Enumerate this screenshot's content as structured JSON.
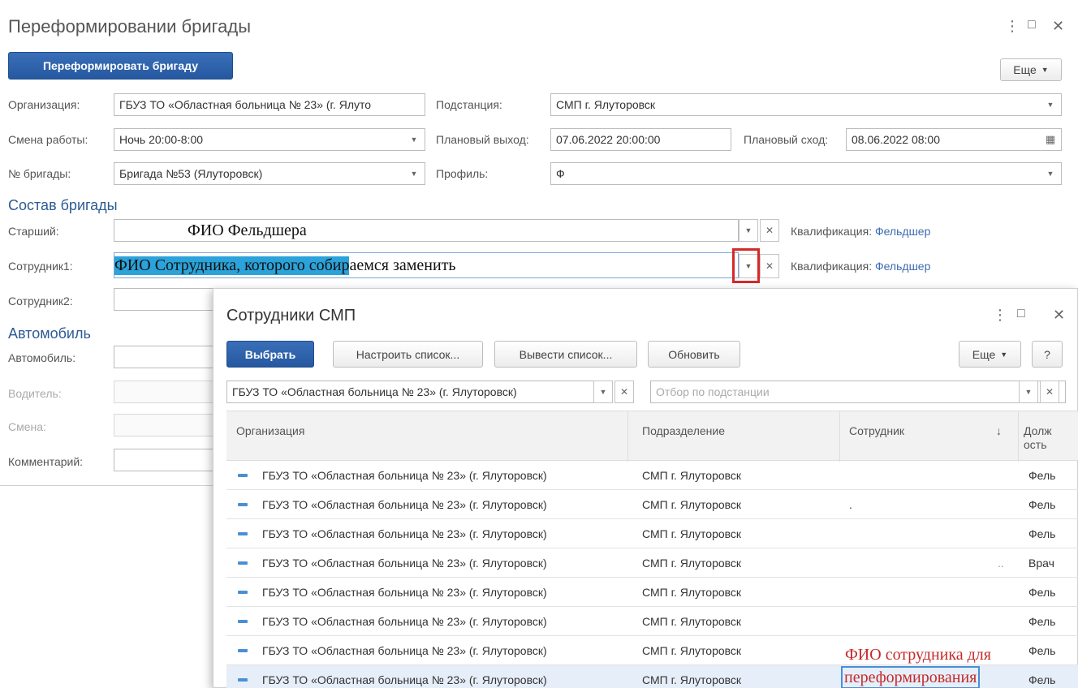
{
  "window": {
    "title": "Переформировании бригады",
    "more_icon": "⋮",
    "maximize_icon": "□",
    "close_icon": "✕"
  },
  "toolbar": {
    "main_button": "Переформировать бригаду",
    "more_button": "Еще"
  },
  "form": {
    "organization_label": "Организация:",
    "organization_value": "ГБУЗ ТО «Областная больница № 23» (г. Ялуто",
    "substation_label": "Подстанция:",
    "substation_value": "СМП г. Ялуторовск",
    "shift_label": "Смена работы:",
    "shift_value": "Ночь 20:00-8:00",
    "planned_exit_label": "Плановый выход:",
    "planned_exit_value": "07.06.2022 20:00:00",
    "planned_return_label": "Плановый сход:",
    "planned_return_value": "08.06.2022 08:00",
    "brigade_no_label": "№ бригады:",
    "brigade_no_value": "Бригада №53 (Ялуторовск)",
    "profile_label": "Профиль:",
    "profile_value": "Ф"
  },
  "composition": {
    "section_title": "Состав бригады",
    "senior_label": "Старший:",
    "senior_value": "ФИО Фельдшера",
    "employee1_label": "Сотрудник1:",
    "employee1_value_selected": "ФИО Сотрудника, которого собир",
    "employee1_value_rest": "аемся заменить",
    "employee2_label": "Сотрудник2:",
    "qualification_label": "Квалификация:",
    "qualification_value": "Фельдшер"
  },
  "vehicle": {
    "section_title": "Автомобиль",
    "vehicle_label": "Автомобиль:",
    "driver_label": "Водитель:",
    "shift_label": "Смена:",
    "comment_label": "Комментарий:"
  },
  "popup": {
    "title": "Сотрудники СМП",
    "select_button": "Выбрать",
    "configure_button": "Настроить список...",
    "output_button": "Вывести список...",
    "refresh_button": "Обновить",
    "more_button": "Еще",
    "help_button": "?",
    "org_filter_value": "ГБУЗ ТО «Областная больница № 23» (г. Ялуторовск)",
    "substation_filter_placeholder": "Отбор по подстанции",
    "columns": [
      "Организация",
      "Подразделение",
      "Сотрудник",
      "Долж ость"
    ],
    "sort_indicator": "↓",
    "rows": [
      {
        "org": "ГБУЗ ТО «Областная больница № 23» (г. Ялуторовск)",
        "dept": "СМП г. Ялуторовск",
        "emp": "",
        "pos": "Фель"
      },
      {
        "org": "ГБУЗ ТО «Областная больница № 23» (г. Ялуторовск)",
        "dept": "СМП г. Ялуторовск",
        "emp": ".",
        "pos": "Фель"
      },
      {
        "org": "ГБУЗ ТО «Областная больница № 23» (г. Ялуторовск)",
        "dept": "СМП г. Ялуторовск",
        "emp": "",
        "pos": "Фель"
      },
      {
        "org": "ГБУЗ ТО «Областная больница № 23» (г. Ялуторовск)",
        "dept": "СМП г. Ялуторовск",
        "emp": "..",
        "pos": "Врач"
      },
      {
        "org": "ГБУЗ ТО «Областная больница № 23» (г. Ялуторовск)",
        "dept": "СМП г. Ялуторовск",
        "emp": "",
        "pos": "Фель"
      },
      {
        "org": "ГБУЗ ТО «Областная больница № 23» (г. Ялуторовск)",
        "dept": "СМП г. Ялуторовск",
        "emp": "",
        "pos": "Фель"
      },
      {
        "org": "ГБУЗ ТО «Областная больница № 23» (г. Ялуторовск)",
        "dept": "СМП г. Ялуторовск",
        "emp": "",
        "pos": "Фель"
      },
      {
        "org": "ГБУЗ ТО «Областная больница № 23» (г. Ялуторовск)",
        "dept": "СМП г. Ялуторовск",
        "emp": "",
        "pos": "Фель"
      }
    ],
    "annotation_line1": "ФИО сотрудника для",
    "annotation_line2": "переформирования"
  },
  "colors": {
    "primary": "#2a5da6",
    "link": "#3d6bb3",
    "highlight": "#2ba2d9",
    "annotation_red": "#d42a2a"
  }
}
